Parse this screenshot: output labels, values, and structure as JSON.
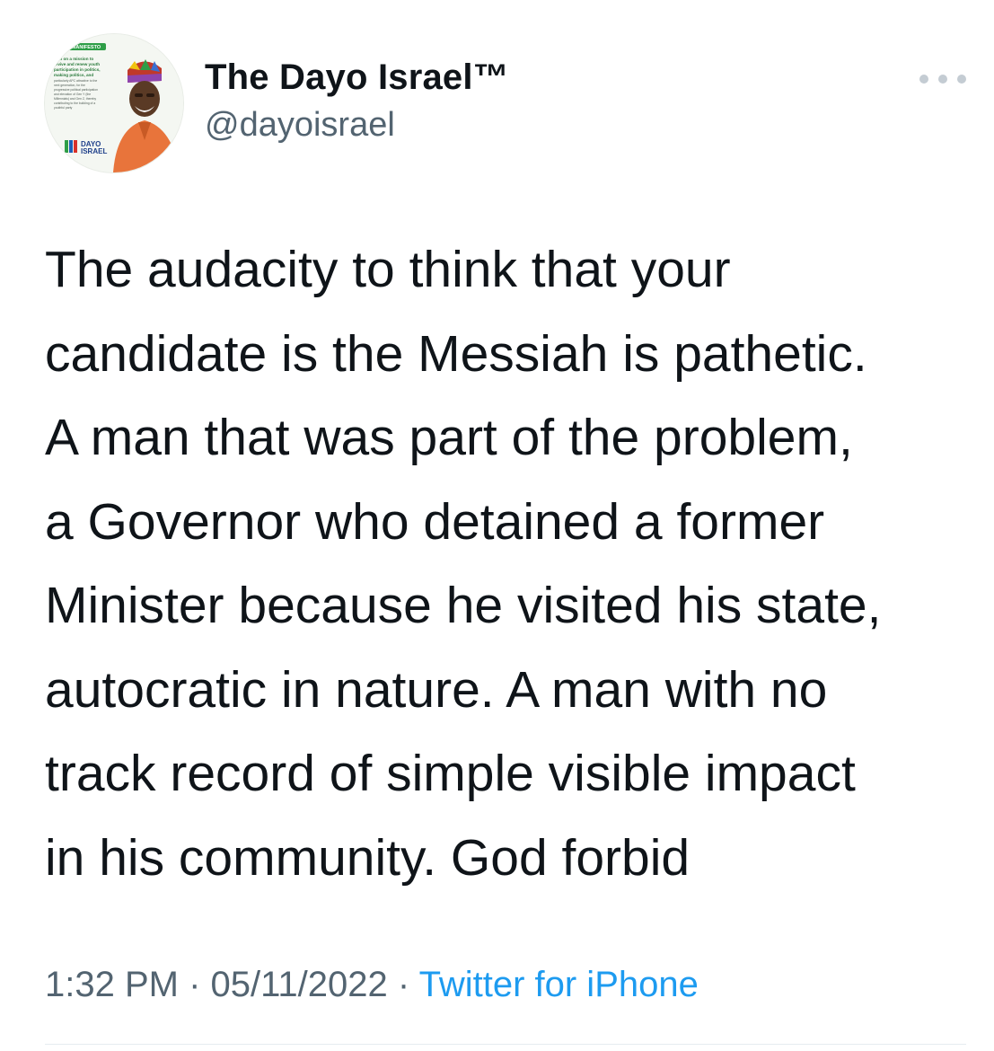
{
  "tweet": {
    "author": {
      "display_name": "The Dayo Israel™",
      "handle": "@dayoisrael",
      "avatar_text": {
        "banner": "MANIFESTO",
        "lines": [
          "I am on a mission to",
          "revive and renew youth",
          "participation in politics,",
          "making politics, and",
          "particularly APC attractive to the",
          "next generation, for the",
          "progressive political participation",
          "and elevation of Gen Y (the",
          "Millennials) and Gen Z, thereby",
          "contributing to the building of a",
          "youthful party"
        ],
        "name_line_1": "DAYO",
        "name_line_2": "ISRAEL"
      }
    },
    "more_icon": "more-horizontal-icon",
    "text": "The audacity to think that your\ncandidate is the Messiah is pathetic.\nA man that was part of the problem,\na Governor who detained a former\nMinister because he visited his state,\nautocratic in nature. A man with no\ntrack record of simple visible impact\nin his community. God forbid",
    "time": "1:32 PM",
    "separator": "·",
    "date": "05/11/2022",
    "source": "Twitter for iPhone"
  },
  "colors": {
    "text_primary": "#0f1419",
    "text_secondary": "#536471",
    "link": "#1d9bf0",
    "divider": "#e6ecf0"
  }
}
